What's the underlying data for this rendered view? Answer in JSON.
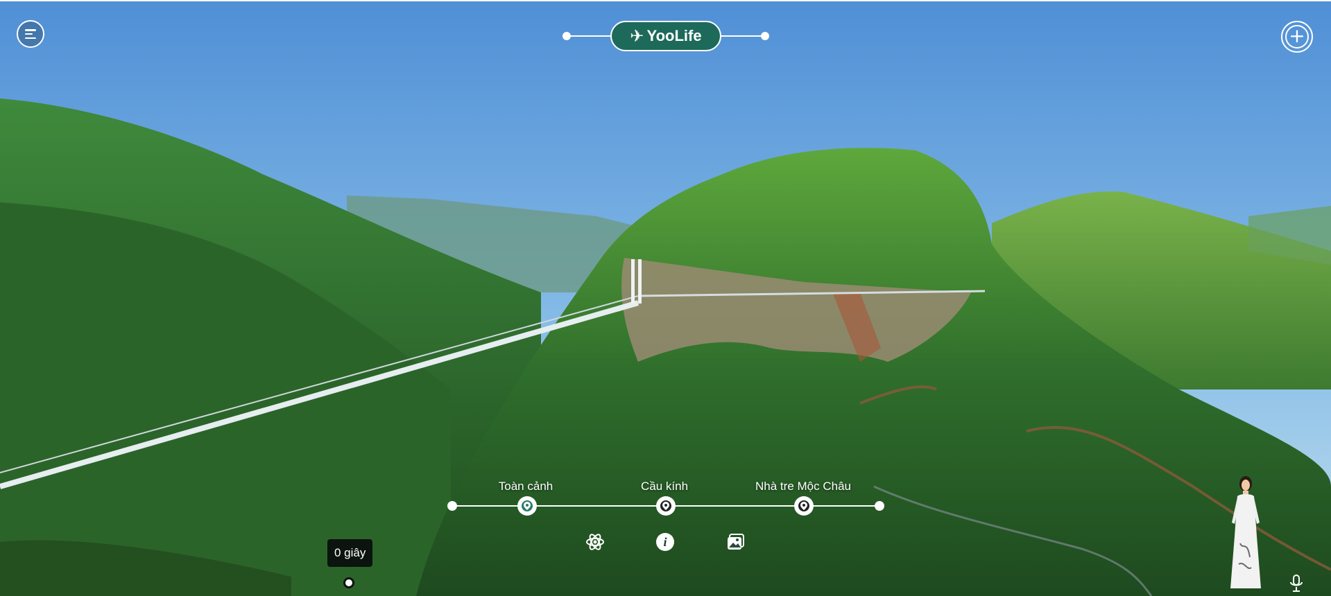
{
  "app": {
    "brand": "YooLife",
    "brand_mark": "✈"
  },
  "colors": {
    "accent": "#1d6a5a",
    "timer_bg": "#0c1410"
  },
  "header": {
    "menu_icon": "hamburger-menu-icon",
    "add_icon": "plus-circle-icon",
    "add_symbol": "+"
  },
  "timeline": {
    "stops": [
      {
        "label": "Toàn cảnh",
        "icon": "map-pin-icon",
        "active": true
      },
      {
        "label": "Cầu kính",
        "icon": "map-pin-icon",
        "active": false
      },
      {
        "label": "Nhà tre Mộc Châu",
        "icon": "map-pin-icon",
        "active": false
      }
    ]
  },
  "actions": [
    {
      "name": "atom-icon"
    },
    {
      "name": "info-icon",
      "glyph": "i"
    },
    {
      "name": "gallery-icon"
    }
  ],
  "timer": {
    "text": "0 giây"
  },
  "assistant": {
    "avatar_icon": "virtual-guide-avatar",
    "mic_icon": "microphone-icon"
  }
}
